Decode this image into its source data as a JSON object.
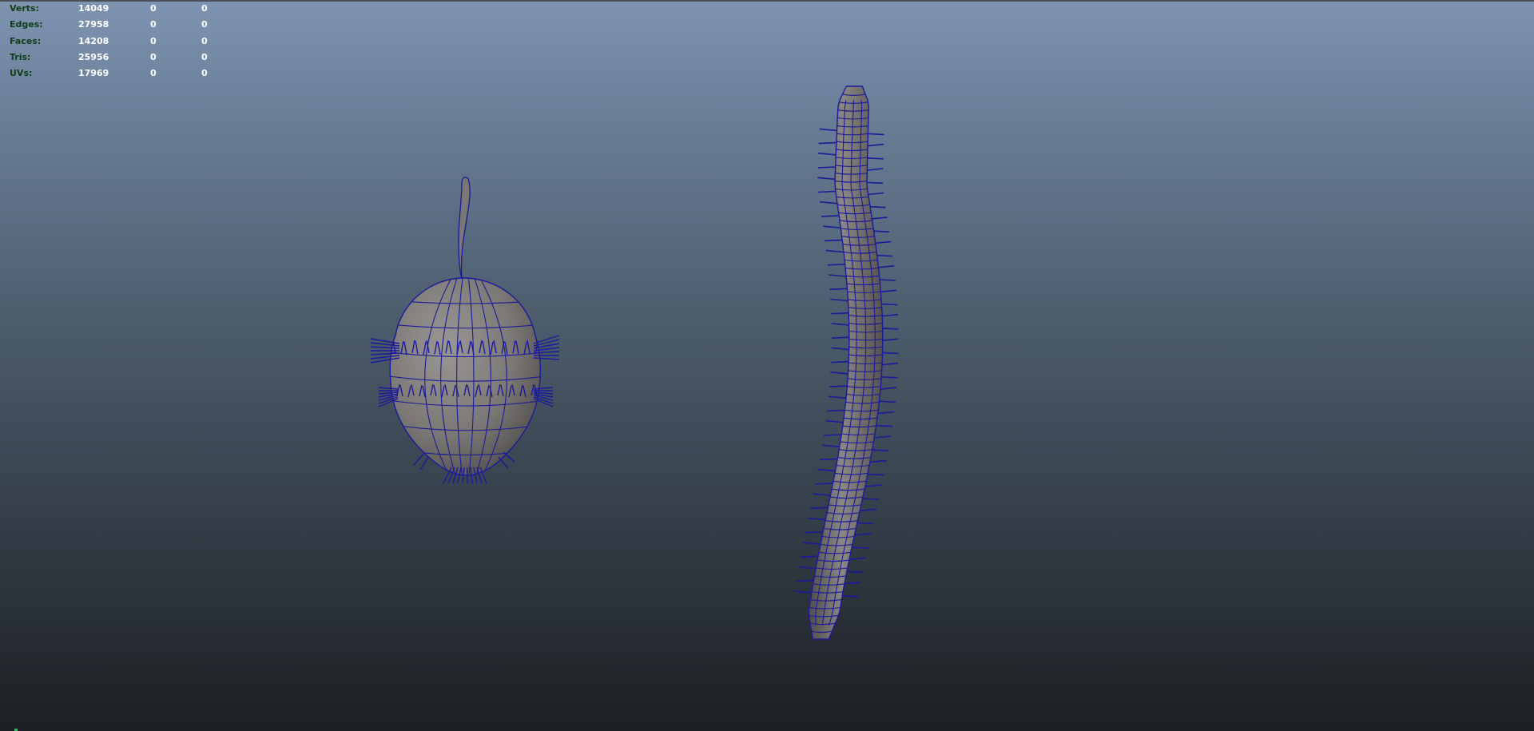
{
  "hud": {
    "rows": [
      {
        "label": "Verts:",
        "v1": "14049",
        "v2": "0",
        "v3": "0"
      },
      {
        "label": "Edges:",
        "v1": "27958",
        "v2": "0",
        "v3": "0"
      },
      {
        "label": "Faces:",
        "v1": "14208",
        "v2": "0",
        "v3": "0"
      },
      {
        "label": "Tris:",
        "v1": "25956",
        "v2": "0",
        "v3": "0"
      },
      {
        "label": "UVs:",
        "v1": "17969",
        "v2": "0",
        "v3": "0"
      }
    ]
  },
  "colors": {
    "wireframe": "#1a1a9a",
    "mesh_fill": "#7a7774",
    "hud_label": "#0e3e16"
  }
}
